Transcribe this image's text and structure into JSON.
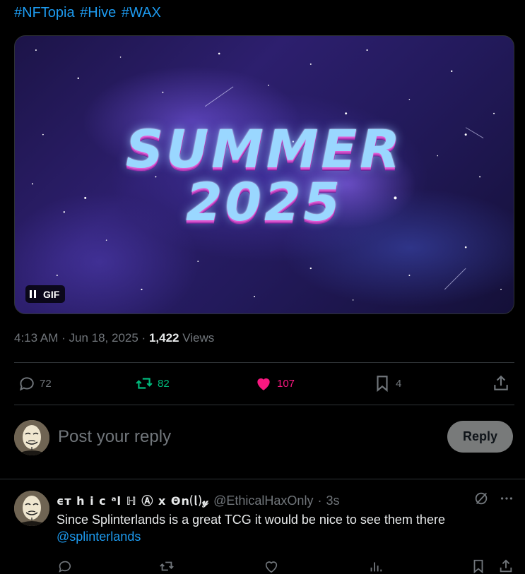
{
  "tweet": {
    "hashtags": [
      "#NFTopia",
      "#Hive",
      "#WAX"
    ],
    "media": {
      "line1": "SUMMER",
      "line2": "2025",
      "badge": "GIF"
    },
    "meta": {
      "time": "4:13 AM",
      "date": "Jun 18, 2025",
      "views_count": "1,422",
      "views_label": "Views"
    },
    "actions": {
      "replies": "72",
      "reposts": "82",
      "likes": "107",
      "bookmarks": "4"
    },
    "colors": {
      "accent": "#1d9bf0",
      "repost_green": "#00ba7c",
      "like_pink": "#f91880",
      "muted": "#71767b"
    }
  },
  "reply_composer": {
    "placeholder": "Post your reply",
    "button_label": "Reply"
  },
  "reply_tweet": {
    "display_name": "ϵт h i c ᵃl ℍ Ⓐ x Θn⒧𝓎",
    "handle": "@EthicalHaxOnly",
    "time": "3s",
    "text": "Since Splinterlands is a great TCG it would be nice to see them there",
    "mention": "@splinterlands"
  }
}
